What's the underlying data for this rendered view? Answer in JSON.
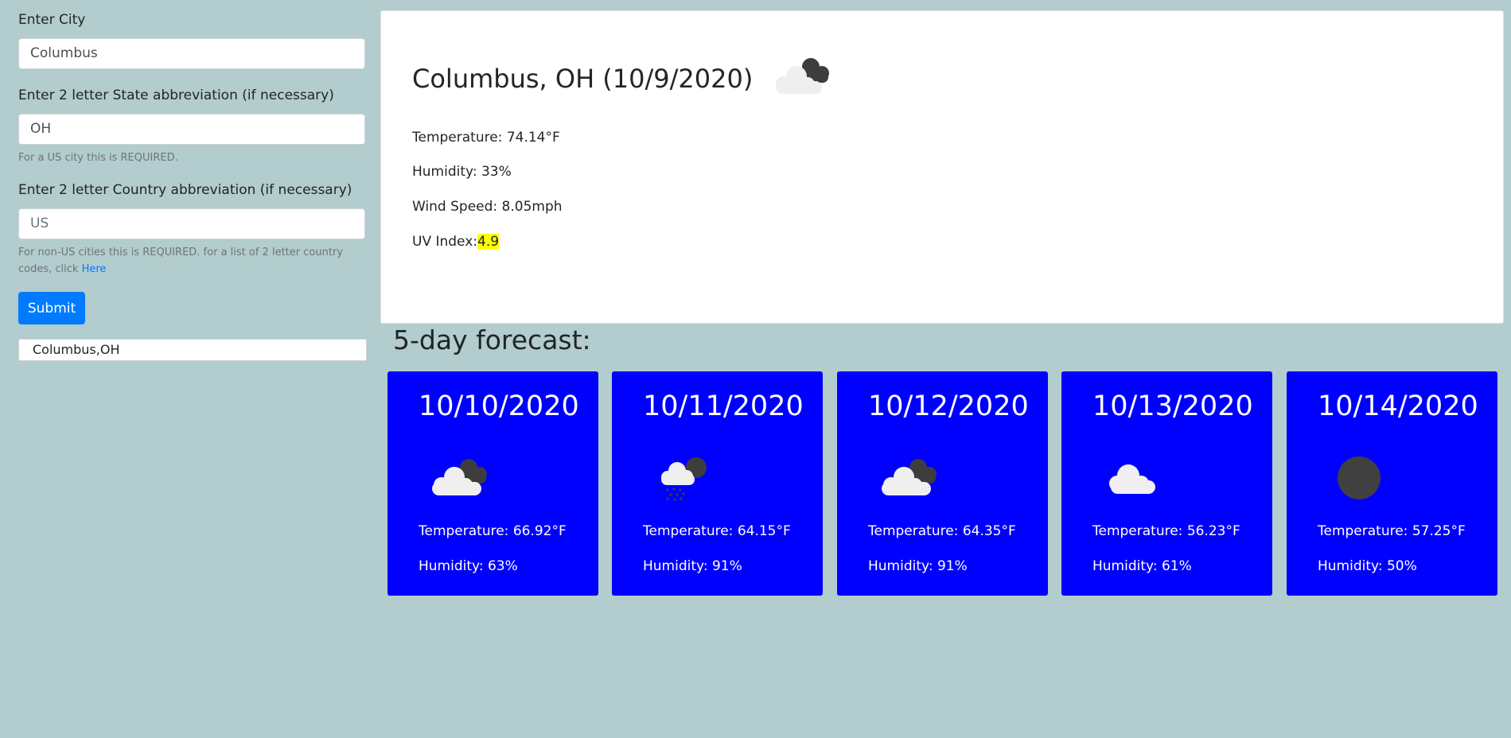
{
  "form": {
    "city_label": "Enter City",
    "city_value": "Columbus",
    "state_label": "Enter 2 letter State abbreviation (if necessary)",
    "state_value": "OH",
    "state_help": "For a US city this is REQUIRED.",
    "country_label": "Enter 2 letter Country abbreviation (if necessary)",
    "country_placeholder": "US",
    "country_help": "For non-US cities this is REQUIRED. for a list of 2 letter country codes, click",
    "country_help_link": "Here",
    "submit_label": "Submit"
  },
  "history": [
    "Columbus,OH"
  ],
  "current": {
    "title": "Columbus, OH (10/9/2020)",
    "icon": "partly-cloudy-icon",
    "temperature": "Temperature: 74.14°F",
    "humidity": "Humidity: 33%",
    "wind": "Wind Speed: 8.05mph",
    "uv_label": "UV Index:",
    "uv_value": "4.9",
    "uv_color": "#ffff00"
  },
  "forecast_heading": "5-day forecast:",
  "forecast": [
    {
      "date": "10/10/2020",
      "icon": "partly-cloudy-icon",
      "temperature": "Temperature: 66.92°F",
      "humidity": "Humidity: 63%"
    },
    {
      "date": "10/11/2020",
      "icon": "cloud-rain-moon-icon",
      "temperature": "Temperature: 64.15°F",
      "humidity": "Humidity: 91%"
    },
    {
      "date": "10/12/2020",
      "icon": "partly-cloudy-icon",
      "temperature": "Temperature: 64.35°F",
      "humidity": "Humidity: 91%"
    },
    {
      "date": "10/13/2020",
      "icon": "cloud-icon",
      "temperature": "Temperature: 56.23°F",
      "humidity": "Humidity: 61%"
    },
    {
      "date": "10/14/2020",
      "icon": "moon-icon",
      "temperature": "Temperature: 57.25°F",
      "humidity": "Humidity: 50%"
    }
  ],
  "colors": {
    "background": "#b3cccd",
    "card": "#0000ff",
    "button": "#007bff",
    "uv_highlight": "#ffff00"
  }
}
